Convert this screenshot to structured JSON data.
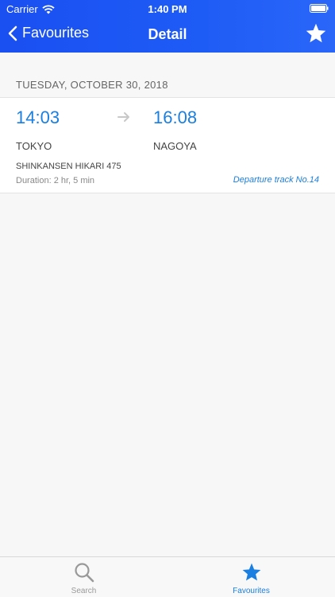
{
  "status_bar": {
    "carrier": "Carrier",
    "time": "1:40 PM"
  },
  "nav": {
    "back_label": "Favourites",
    "title": "Detail",
    "star_icon": "star-icon"
  },
  "colors": {
    "nav_gradient_start": "#1a4ff2",
    "nav_gradient_end": "#2a66f8",
    "accent": "#1a7fe0"
  },
  "trip": {
    "date": "TUESDAY, OCTOBER 30, 2018",
    "departure_time": "14:03",
    "arrival_time": "16:08",
    "departure_station": "TOKYO",
    "arrival_station": "NAGOYA",
    "train": "SHINKANSEN HIKARI 475",
    "duration": "Duration: 2 hr, 5 min",
    "track": "Departure track No.14"
  },
  "tabs": [
    {
      "label": "Search",
      "icon": "search-icon",
      "selected": false
    },
    {
      "label": "Favourites",
      "icon": "star-icon",
      "selected": true
    }
  ]
}
